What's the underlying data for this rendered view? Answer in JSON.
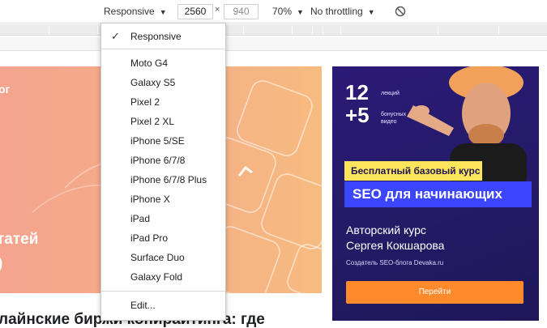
{
  "toolbar": {
    "device_label": "Responsive",
    "width_value": "2560",
    "times_sign": "×",
    "height_value": "940",
    "zoom_label": "70%",
    "throttle_label": "No throttling",
    "rotate_icon": "no-rotate-icon"
  },
  "menu": {
    "selected": "Responsive",
    "top_item": "Responsive",
    "devices": [
      "Moto G4",
      "Galaxy S5",
      "Pixel 2",
      "Pixel 2 XL",
      "iPhone 5/SE",
      "iPhone 6/7/8",
      "iPhone 6/7/8 Plus",
      "iPhone X",
      "iPad",
      "iPad Pro",
      "Surface Duo",
      "Galaxy Fold"
    ],
    "edit_label": "Edit..."
  },
  "hero": {
    "top_text": "ог",
    "mid_text": "татей",
    "low_text": ")"
  },
  "article": {
    "title": "лайнские биржи копирайтинга: где"
  },
  "ad": {
    "num_top": "12",
    "num_bottom": "+5",
    "label_top": "лекций",
    "label_bottom": "бонусных видео",
    "tag_yellow": "Бесплатный базовый курс",
    "tag_blue": "SEO для начинающих",
    "course_line1": "Авторский курс",
    "course_line2": "Сергея Кокшарова",
    "author": "Создатель SEO-блога Devaka.ru",
    "button": "Перейти"
  },
  "colors": {
    "hero_start": "#f4a48f",
    "hero_end": "#f7bb80",
    "ad_bg": "#2b1a78",
    "ad_yellow": "#ffe55c",
    "ad_blue": "#3d46ff",
    "ad_button": "#ff8a2b"
  }
}
